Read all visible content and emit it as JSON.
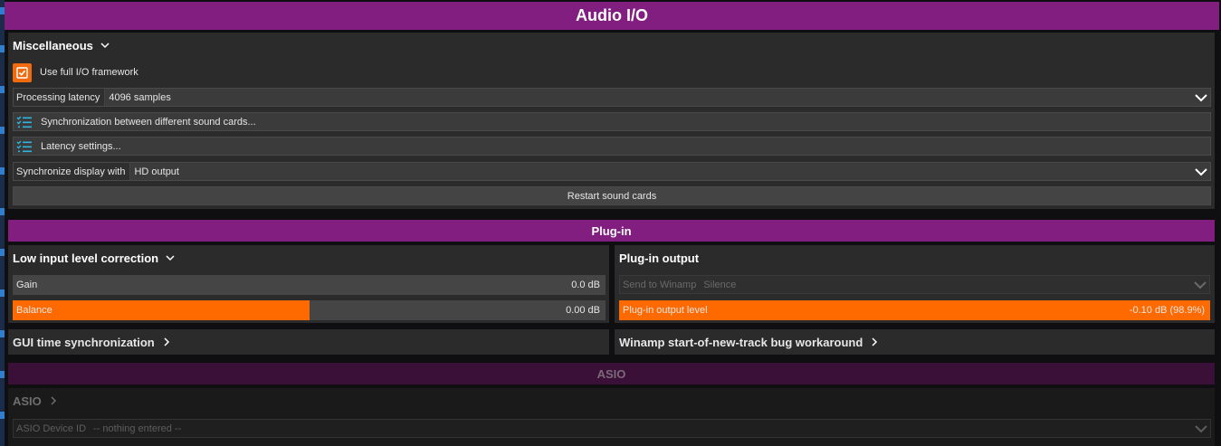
{
  "window": {
    "title": "Audio I/O"
  },
  "misc": {
    "header": "Miscellaneous",
    "use_full_io_label": "Use full I/O framework",
    "use_full_io_checked": true,
    "processing_latency_label": "Processing latency",
    "processing_latency_value": "4096 samples",
    "sync_cards_label": "Synchronization between different sound cards...",
    "latency_settings_label": "Latency settings...",
    "sync_display_label": "Synchronize display with",
    "sync_display_value": "HD output",
    "restart_label": "Restart sound cards"
  },
  "plugin": {
    "header": "Plug-in",
    "low_input": {
      "header": "Low input level correction",
      "gain_label": "Gain",
      "gain_value": "0.0 dB",
      "gain_fraction": 0.0,
      "balance_label": "Balance",
      "balance_value": "0.00 dB",
      "balance_fraction": 0.5
    },
    "output": {
      "header": "Plug-in output",
      "send_label": "Send to Winamp",
      "send_value": "Silence",
      "level_label": "Plug-in output level",
      "level_value": "-0.10 dB (98.9%)",
      "level_fraction": 1.0
    },
    "gui_sync_header": "GUI time synchronization",
    "winamp_bug_header": "Winamp start-of-new-track bug workaround"
  },
  "asio": {
    "header": "ASIO",
    "sub_header": "ASIO",
    "device_label": "ASIO Device ID",
    "device_value": "-- nothing entered --"
  },
  "colors": {
    "accent": "#811e80",
    "accent_dim": "#3a1038",
    "orange": "#ff6a00",
    "panel": "#2b2b2b"
  }
}
